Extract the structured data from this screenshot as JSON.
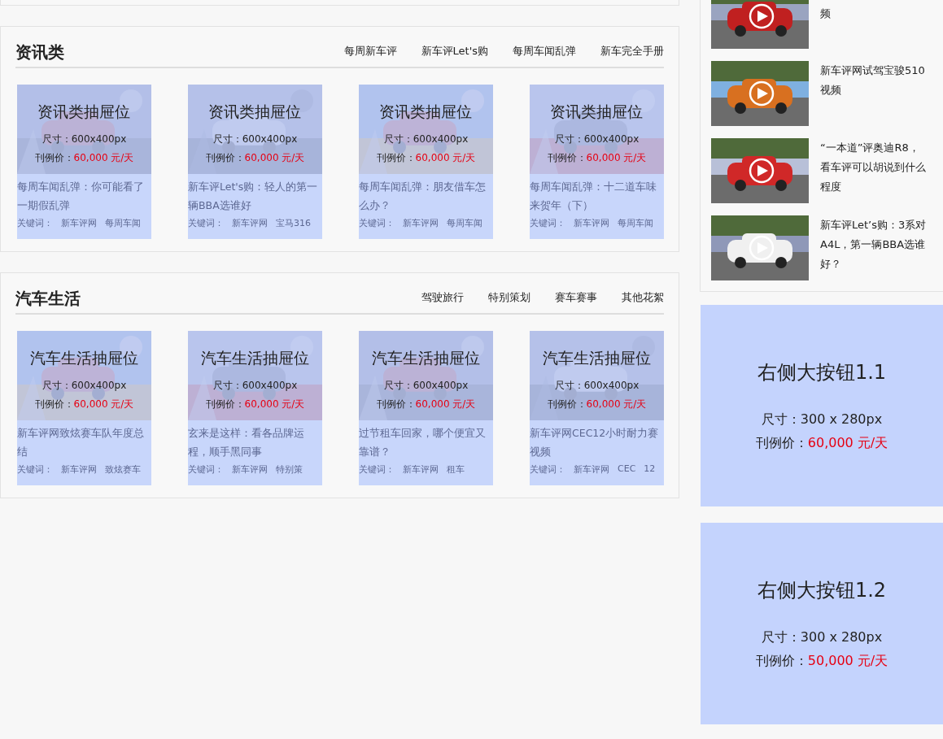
{
  "sections": [
    {
      "title": "资讯类",
      "tabs": [
        "每周新车评",
        "新车评Let's购",
        "每周车闻乱弹",
        "新车完全手册"
      ],
      "cards": [
        {
          "slot_title": "资讯类抽屉位",
          "size_label": "尺寸：",
          "size_value": "600x400px",
          "price_label": "刊例价：",
          "price_value": "60,000 元/天",
          "article_title": "每周车闻乱弹：你可能看了一期假乱弹",
          "keywords_label": "关键词：",
          "keywords": [
            "新车评网",
            "每周车闻"
          ]
        },
        {
          "slot_title": "资讯类抽屉位",
          "size_label": "尺寸：",
          "size_value": "600x400px",
          "price_label": "刊例价：",
          "price_value": "60,000 元/天",
          "article_title": "新车评Let's购：轻人的第一辆BBA选谁好",
          "keywords_label": "关键词：",
          "keywords": [
            "新车评网",
            "宝马316"
          ]
        },
        {
          "slot_title": "资讯类抽屉位",
          "size_label": "尺寸：",
          "size_value": "600x400px",
          "price_label": "刊例价：",
          "price_value": "60,000 元/天",
          "article_title": "每周车闻乱弹：朋友借车怎么办？",
          "keywords_label": "关键词：",
          "keywords": [
            "新车评网",
            "每周车闻"
          ]
        },
        {
          "slot_title": "资讯类抽屉位",
          "size_label": "尺寸：",
          "size_value": "600x400px",
          "price_label": "刊例价：",
          "price_value": "60,000 元/天",
          "article_title": "每周车闻乱弹：十二道车味来贺年（下）",
          "keywords_label": "关键词：",
          "keywords": [
            "新车评网",
            "每周车闻"
          ]
        }
      ]
    },
    {
      "title": "汽车生活",
      "tabs": [
        "驾驶旅行",
        "特别策划",
        "赛车赛事",
        "其他花絮"
      ],
      "cards": [
        {
          "slot_title": "汽车生活抽屉位",
          "size_label": "尺寸：",
          "size_value": "600x400px",
          "price_label": "刊例价：",
          "price_value": "60,000 元/天",
          "article_title": "新车评网致炫赛车队年度总结",
          "keywords_label": "关键词：",
          "keywords": [
            "新车评网",
            "致炫赛车"
          ]
        },
        {
          "slot_title": "汽车生活抽屉位",
          "size_label": "尺寸：",
          "size_value": "600x400px",
          "price_label": "刊例价：",
          "price_value": "60,000 元/天",
          "article_title": "玄来是这样：看各品牌运程，顺手黑同事",
          "keywords_label": "关键词：",
          "keywords": [
            "新车评网",
            "特别策"
          ]
        },
        {
          "slot_title": "汽车生活抽屉位",
          "size_label": "尺寸：",
          "size_value": "600x400px",
          "price_label": "刊例价：",
          "price_value": "60,000 元/天",
          "article_title": "过节租车回家，哪个便宜又靠谱？",
          "keywords_label": "关键词：",
          "keywords": [
            "新车评网",
            "租车"
          ]
        },
        {
          "slot_title": "汽车生活抽屉位",
          "size_label": "尺寸：",
          "size_value": "600x400px",
          "price_label": "刊例价：",
          "price_value": "60,000 元/天",
          "article_title": "新车评网CEC12小时耐力赛视频",
          "keywords_label": "关键词：",
          "keywords": [
            "新车评网",
            "CEC",
            "12"
          ]
        }
      ]
    }
  ],
  "video_list": [
    {
      "title": "频"
    },
    {
      "title": "新车评网试驾宝骏510视频"
    },
    {
      "title": "“一本道”评奥迪R8，看车评可以胡说到什么程度"
    },
    {
      "title": "新车评Let’s购：3系对A4L，第一辆BBA选谁好？"
    }
  ],
  "ad_buttons": [
    {
      "title": "右侧大按钮1.1",
      "size_label": "尺寸：",
      "size_value": "300 x 280px",
      "price_label": "刊例价：",
      "price_value": "60,000 元/天"
    },
    {
      "title": "右侧大按钮1.2",
      "size_label": "尺寸：",
      "size_value": "300 x 280px",
      "price_label": "刊例价：",
      "price_value": "50,000 元/天"
    }
  ]
}
